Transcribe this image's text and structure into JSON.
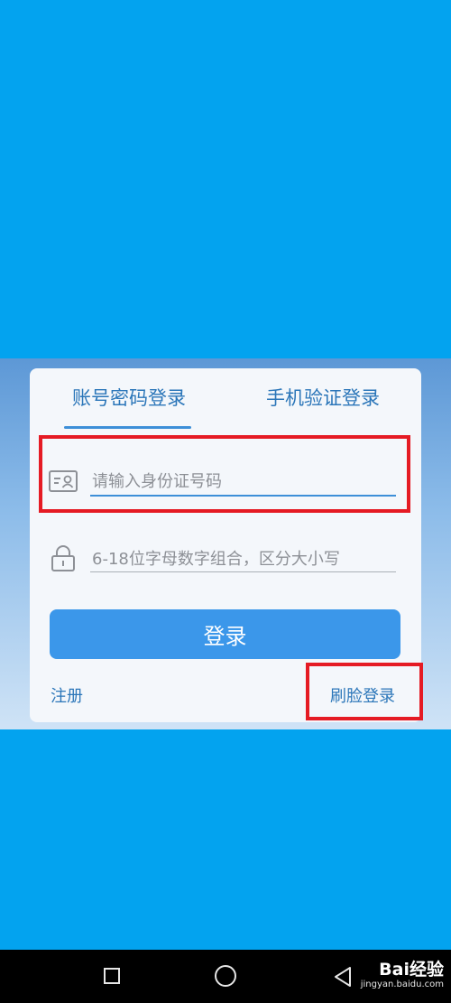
{
  "tabs": {
    "account_password": "账号密码登录",
    "phone_verify": "手机验证登录"
  },
  "id_field": {
    "placeholder": "请输入身份证号码",
    "value": ""
  },
  "password_field": {
    "placeholder": "6-18位字母数字组合，区分大小写",
    "value": ""
  },
  "login_button": "登录",
  "links": {
    "register": "注册",
    "face_login": "刷脸登录"
  },
  "colors": {
    "background": "#03a3ef",
    "accent": "#3b97ea",
    "link": "#2b76b9",
    "highlight": "#e51b24"
  },
  "icons": {
    "id_card": "id-card-icon",
    "lock": "lock-icon",
    "nav_recent": "square-icon",
    "nav_home": "circle-icon",
    "nav_back": "triangle-back-icon"
  },
  "watermark": {
    "brand": "Bai经验",
    "url": "jingyan.baidu.com"
  }
}
